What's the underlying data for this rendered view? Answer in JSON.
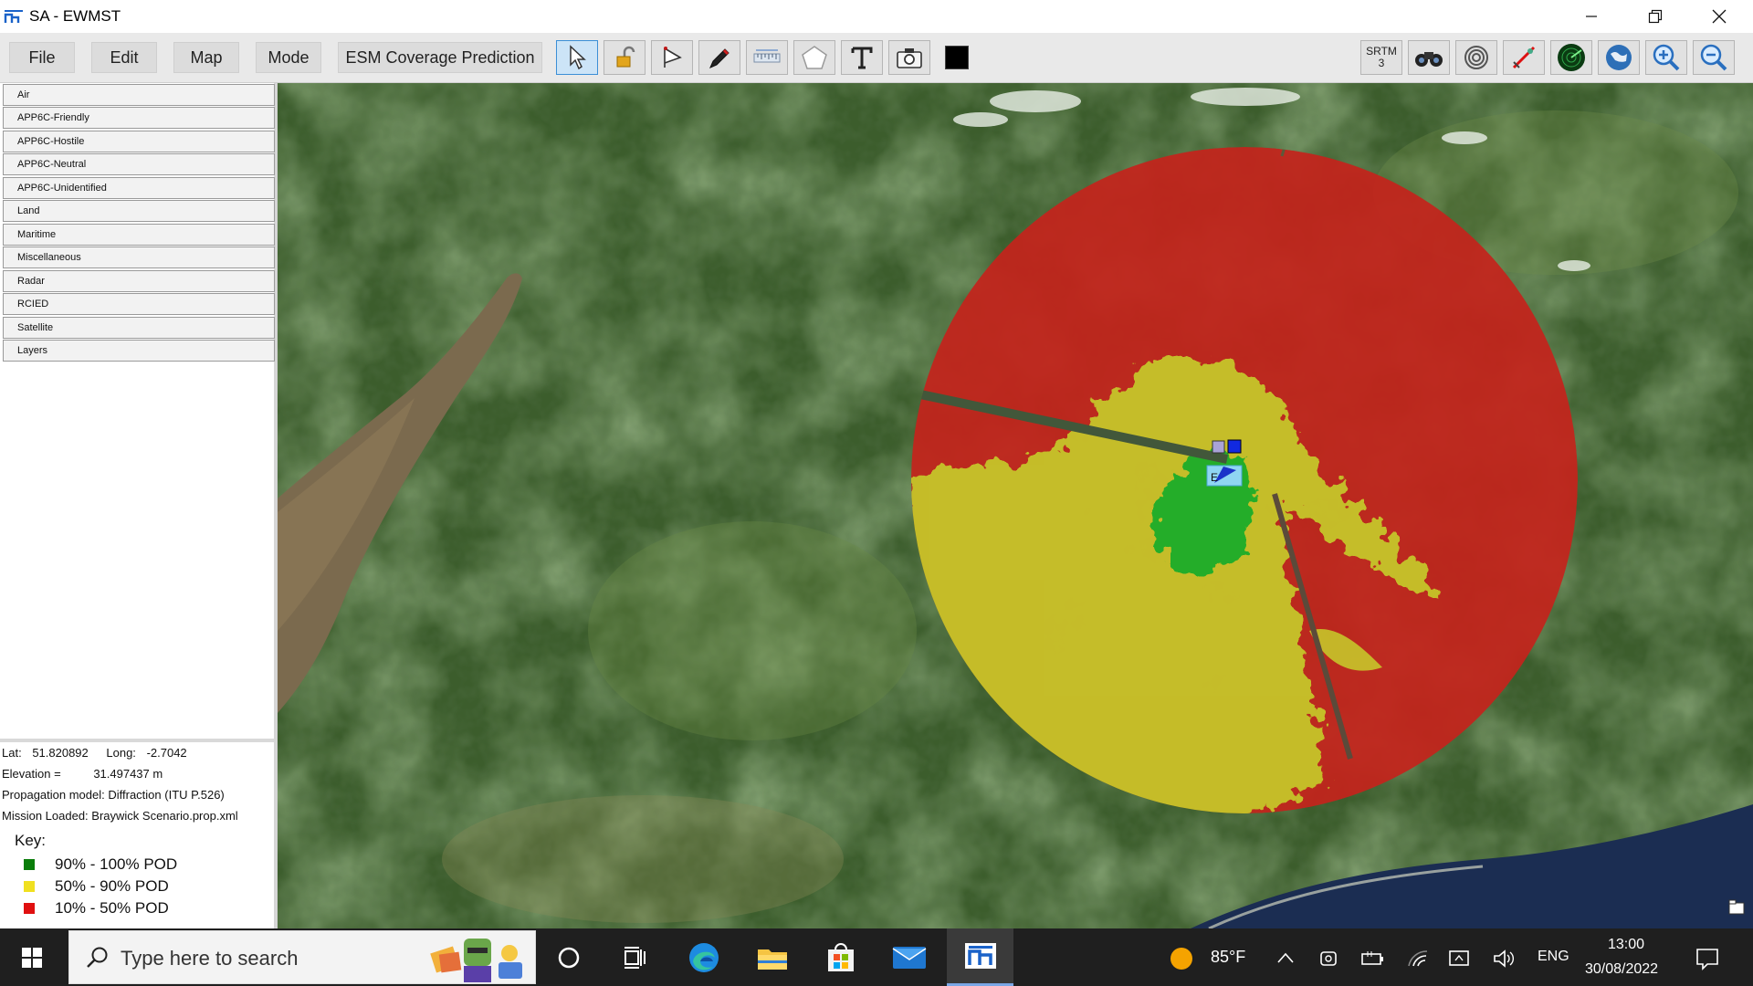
{
  "window": {
    "title": "SA - EWMST"
  },
  "menu": {
    "file": "File",
    "edit": "Edit",
    "map": "Map",
    "mode": "Mode",
    "esm": "ESM Coverage Prediction"
  },
  "toolbar": {
    "left_tools": [
      "pointer-select-icon",
      "lock-icon",
      "flag-icon",
      "pen-icon",
      "ruler-icon",
      "pentagon-icon",
      "text-tool-icon",
      "camera-icon",
      "color-swatch-icon"
    ],
    "srtm_label": "SRTM",
    "srtm_value": "3",
    "right_tools": [
      "binoculars-icon",
      "target-rings-icon",
      "compass-icon",
      "radar-icon",
      "globe-icon",
      "zoom-in-icon",
      "zoom-out-icon"
    ],
    "color_swatch": "#000000"
  },
  "categories": [
    "Air",
    "APP6C-Friendly",
    "APP6C-Hostile",
    "APP6C-Neutral",
    "APP6C-Unidentified",
    "Land",
    "Maritime",
    "Miscellaneous",
    "Radar",
    "RCIED",
    "Satellite",
    "Layers"
  ],
  "info": {
    "lat_label": "Lat:",
    "lat_value": "51.820892",
    "long_label": "Long:",
    "long_value": "-2.7042",
    "elevation_label": "Elevation =",
    "elevation_value": "31.497437 m",
    "propagation": "Propagation model: Diffraction (ITU P.526)",
    "mission": "Mission Loaded: Braywick Scenario.prop.xml"
  },
  "key": {
    "title": "Key:",
    "items": [
      {
        "label": "90% - 100% POD",
        "color": "#0a7d0a"
      },
      {
        "label": "50% - 90% POD",
        "color": "#f0e020"
      },
      {
        "label": "10% - 50% POD",
        "color": "#e01010"
      }
    ]
  },
  "coverage": {
    "green": "#1fb51f",
    "yellow": "#c8c71a",
    "red": "#c0201a"
  },
  "taskbar": {
    "search_placeholder": "Type here to search",
    "temperature": "85°F",
    "language": "ENG",
    "time": "13:00",
    "date": "30/08/2022"
  }
}
